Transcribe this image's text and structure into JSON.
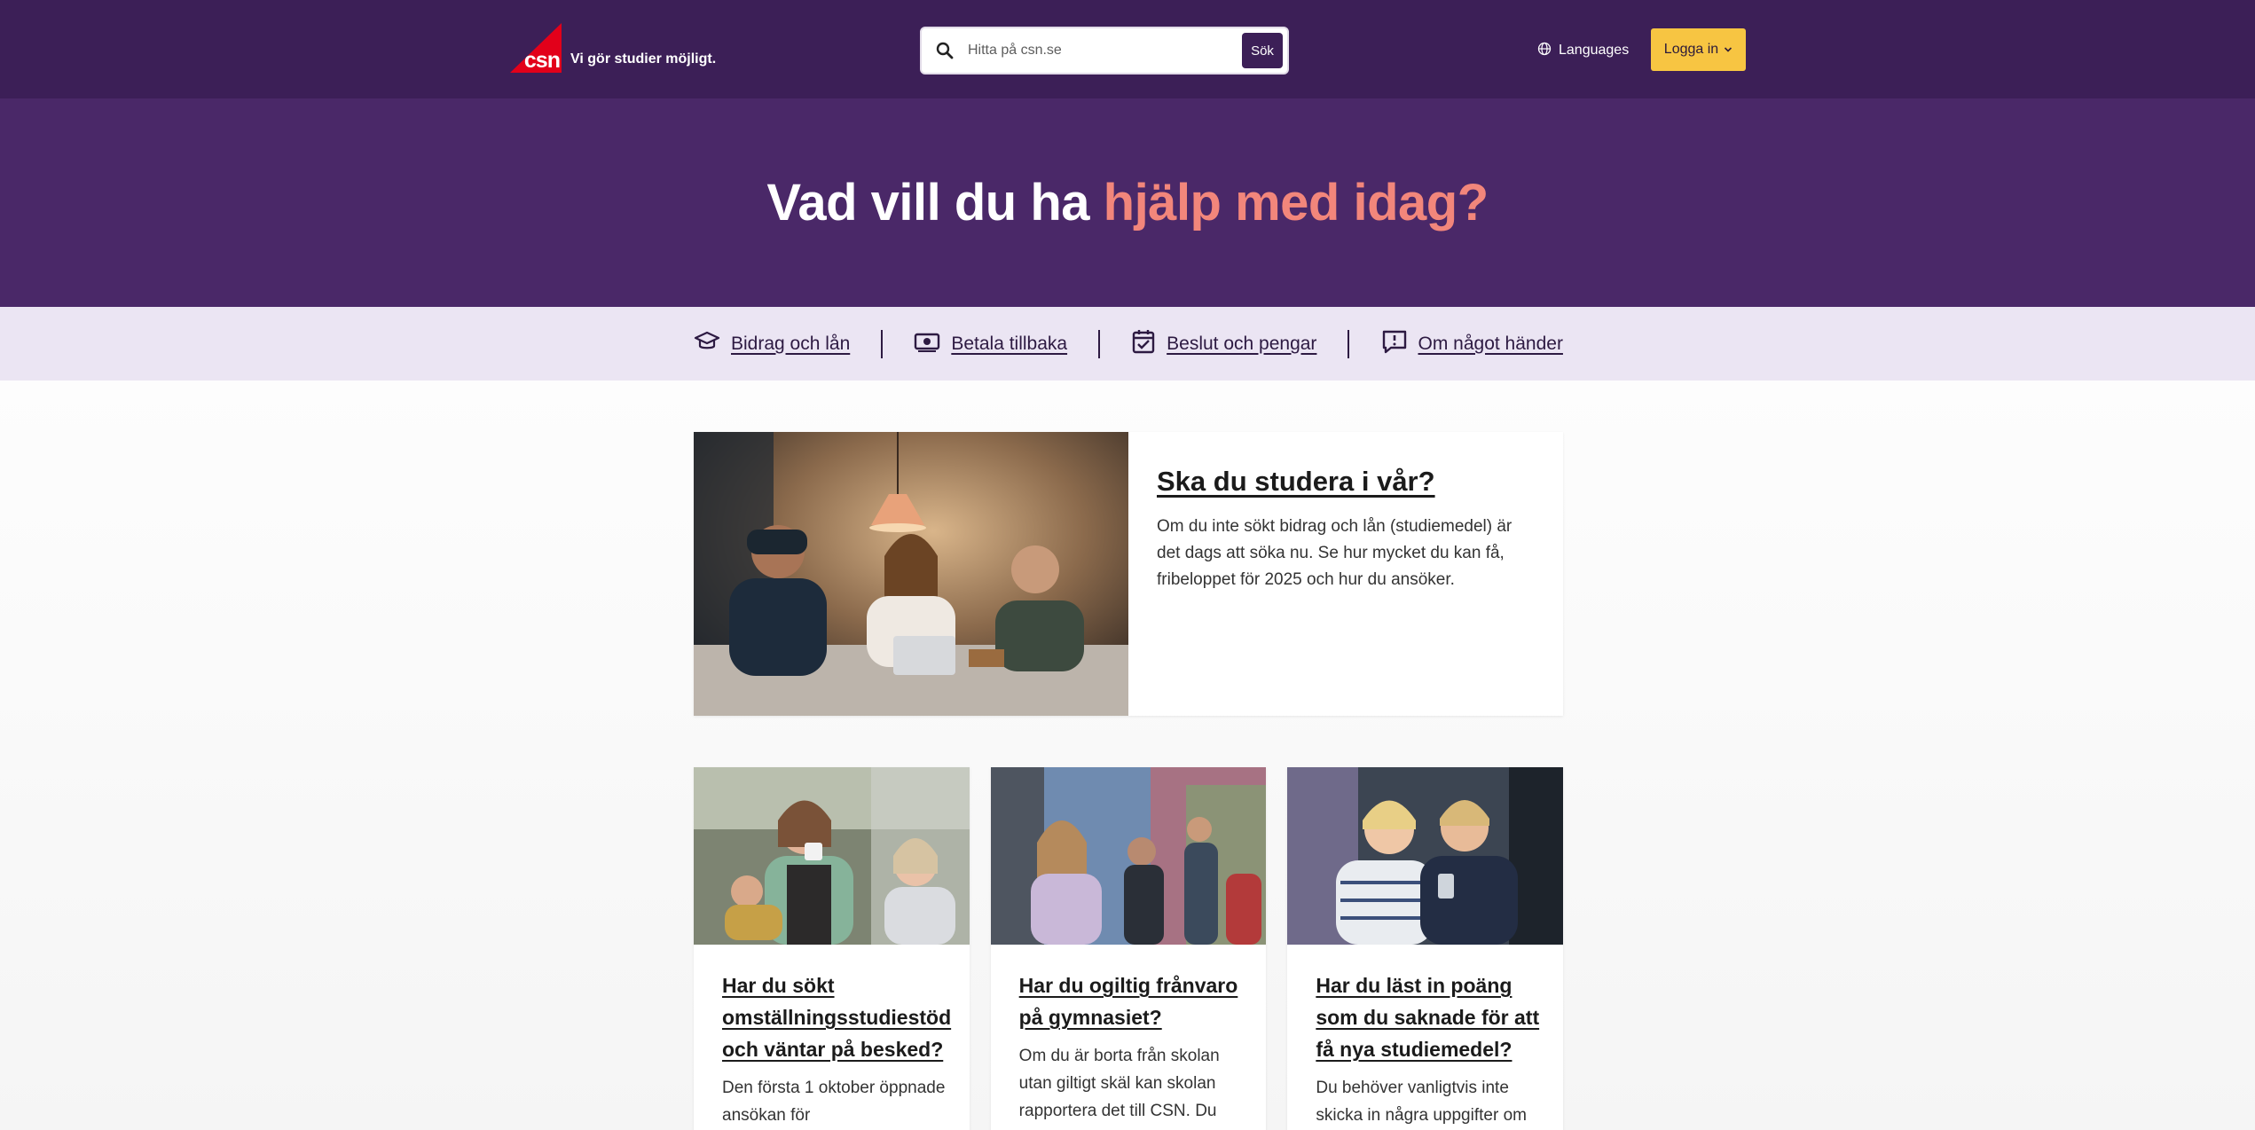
{
  "header": {
    "logo_text": "csn",
    "tagline": "Vi gör studier möjligt.",
    "search": {
      "placeholder": "Hitta på csn.se",
      "button_label": "Sök"
    },
    "languages_label": "Languages",
    "login_label": "Logga in"
  },
  "hero": {
    "title_main": "Vad vill du ha ",
    "title_accent": "hjälp med idag?"
  },
  "quicknav": {
    "items": [
      {
        "label": "Bidrag och lån",
        "icon": "graduation-cap-icon"
      },
      {
        "label": "Betala tillbaka",
        "icon": "money-icon"
      },
      {
        "label": "Beslut och pengar",
        "icon": "calendar-check-icon"
      },
      {
        "label": "Om något händer",
        "icon": "alert-message-icon"
      }
    ]
  },
  "featured": {
    "title": "Ska du studera i vår?",
    "text": "Om du inte sökt bidrag och lån (studiemedel) är det dags att söka nu. Se hur mycket du kan få, fribeloppet för 2025 och hur du ansöker."
  },
  "cards": [
    {
      "title": "Har du sökt omställningsstudiestöd och väntar på besked?",
      "text": "Den första 1 oktober öppnade ansökan för"
    },
    {
      "title": "Har du ogiltig frånvaro på gymnasiet?",
      "text": "Om du är borta från skolan utan giltigt skäl kan skolan rapportera det till CSN. Du"
    },
    {
      "title": "Har du läst in poäng som du saknade för att få nya studiemedel?",
      "text": "Du behöver vanligtvis inte skicka in några uppgifter om"
    }
  ],
  "colors": {
    "header_bg": "#3c1f57",
    "hero_bg": "#4a2868",
    "hero_accent": "#f2867b",
    "quicknav_bg": "#ebe5f3",
    "login_bg": "#f7c542",
    "logo_red": "#e2001a"
  }
}
